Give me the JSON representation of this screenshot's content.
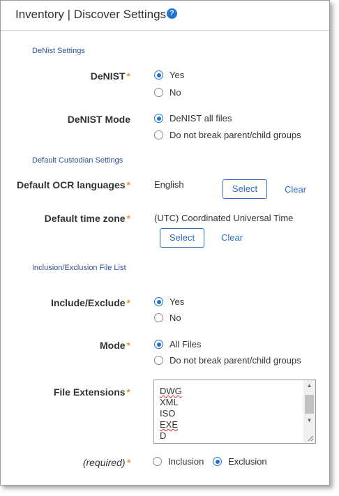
{
  "header": {
    "title": "Inventory | Discover Settings",
    "help_glyph": "?"
  },
  "denist_section": {
    "heading": "DeNist Settings",
    "denist": {
      "label": "DeNIST",
      "required": "*",
      "options": [
        "Yes",
        "No"
      ],
      "selected": "Yes"
    },
    "denist_mode": {
      "label": "DeNIST Mode",
      "options": [
        "DeNIST all files",
        "Do not break parent/child groups"
      ],
      "selected": "DeNIST all files"
    }
  },
  "custodian_section": {
    "heading": "Default Custodian Settings",
    "ocr": {
      "label": "Default OCR languages",
      "required": "*",
      "value": "English",
      "select_label": "Select",
      "clear_label": "Clear"
    },
    "timezone": {
      "label": "Default time zone",
      "required": "*",
      "value": "(UTC) Coordinated Universal Time",
      "select_label": "Select",
      "clear_label": "Clear"
    }
  },
  "inclusion_section": {
    "heading": "Inclusion/Exclusion File List",
    "include_exclude": {
      "label": "Include/Exclude",
      "required": "*",
      "options": [
        "Yes",
        "No"
      ],
      "selected": "Yes"
    },
    "mode": {
      "label": "Mode",
      "required": "*",
      "options": [
        "All Files",
        "Do not break parent/child groups"
      ],
      "selected": "All Files"
    },
    "file_extensions": {
      "label": "File Extensions",
      "required": "*",
      "items": [
        "DWG",
        "XML",
        "ISO",
        "EXE",
        "D"
      ]
    },
    "list_type": {
      "label": "(required)",
      "required": "*",
      "options": [
        "Inclusion",
        "Exclusion"
      ],
      "selected": "Exclusion"
    }
  },
  "colors": {
    "accent": "#1f73d1",
    "required_marker": "#e39b3c",
    "section_heading": "#2c4f8f"
  }
}
